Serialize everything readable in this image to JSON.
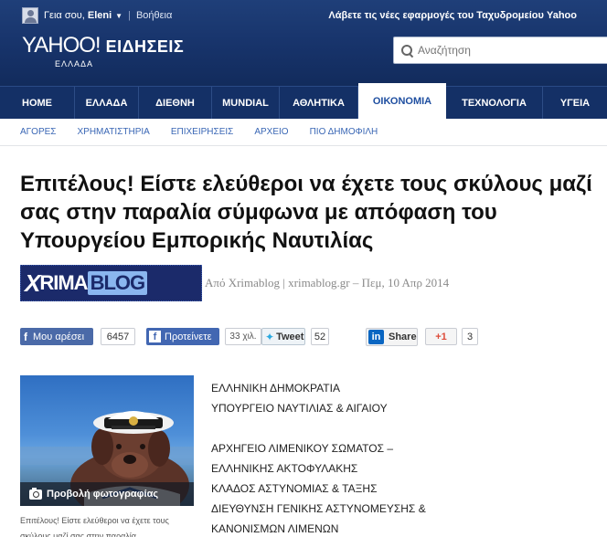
{
  "header": {
    "greeting_prefix": "Γεια σου, ",
    "user_name": "Eleni",
    "help_label": "Βοήθεια",
    "promo_text": "Λάβετε τις νέες εφαρμογές του Ταχυδρομείου Yahoo",
    "logo_text": "YAHOO!",
    "logo_section": "ΕΙΔΗΣΕΙΣ",
    "logo_region": "ΕΛΛΑΔΑ",
    "search_placeholder": "Αναζήτηση"
  },
  "nav": {
    "items": [
      {
        "label": "HOME"
      },
      {
        "label": "ΕΛΛΑΔΑ"
      },
      {
        "label": "ΔΙΕΘΝΗ"
      },
      {
        "label": "MUNDIAL"
      },
      {
        "label": "ΑΘΛΗΤΙΚΑ"
      },
      {
        "label": "ΟΙΚΟΝΟΜΙΑ"
      },
      {
        "label": "ΤΕΧΝΟΛΟΓΙΑ"
      },
      {
        "label": "ΥΓΕΙΑ"
      }
    ],
    "active_index": 5
  },
  "subnav": {
    "items": [
      "ΑΓΟΡΕΣ",
      "ΧΡΗΜΑΤΙΣΤΗΡΙΑ",
      "ΕΠΙΧΕΙΡΗΣΕΙΣ",
      "ΑΡΧΕΙΟ",
      "ΠΙΟ ΔΗΜΟΦΙΛΗ"
    ]
  },
  "article": {
    "headline": "Επιτέλους! Είστε ελεύθεροι να έχετε τους σκύλους μαζί σας στην παραλία σύμφωνα με απόφαση του Υπουργείου Εμπορικής Ναυτιλίας",
    "source_logo_prefix": "X",
    "source_logo_name": "RIMA",
    "source_logo_suffix": "BLOG",
    "byline": "Από Xrimablog | xrimablog.gr – Πεμ, 10 Απρ 2014"
  },
  "social": {
    "fb_like_label": "Μου αρέσει",
    "fb_like_count": "6457",
    "fb_recommend_label": "Προτείνετε",
    "fb_recommend_count": "33 χιλ.",
    "tweet_label": "Tweet",
    "tweet_count": "52",
    "linkedin_label": "Share",
    "gplus_label": "+1",
    "gplus_count": "3"
  },
  "photo": {
    "overlay_label": "Προβολή φωτογραφίας",
    "caption": "Επιτέλους! Είστε ελεύθεροι να έχετε τους σκύλους μαζί σας στην παραλία"
  },
  "body": {
    "lines_block1": [
      "ΕΛΛΗΝΙΚΗ ΔΗΜΟΚΡΑΤΙΑ",
      "ΥΠΟΥΡΓΕΙΟ ΝΑΥΤΙΛΙΑΣ & ΑΙΓΑΙΟΥ"
    ],
    "lines_block2": [
      "ΑΡΧΗΓΕΙΟ ΛΙΜΕΝΙΚΟΥ ΣΩΜΑΤΟΣ –",
      "ΕΛΛΗΝΙΚΗΣ ΑΚΤΟΦΥΛΑΚΗΣ",
      "ΚΛΑΔΟΣ ΑΣΤΥΝΟΜΙΑΣ & ΤΑΞΗΣ",
      "ΔΙΕΥΘΥΝΣΗ ΓΕΝΙΚΗΣ ΑΣΤΥΝΟΜΕΥΣΗΣ &",
      "ΚΑΝΟΝΙΣΜΩΝ ΛΙΜΕΝΩΝ"
    ]
  },
  "colors": {
    "header_bg": "#17336a",
    "nav_bg": "#143066",
    "link_blue": "#3a67b5",
    "active_tab_text": "#1e4ea0"
  },
  "icons": {
    "user": "user-avatar-icon",
    "search": "search-icon",
    "camera": "camera-icon"
  }
}
